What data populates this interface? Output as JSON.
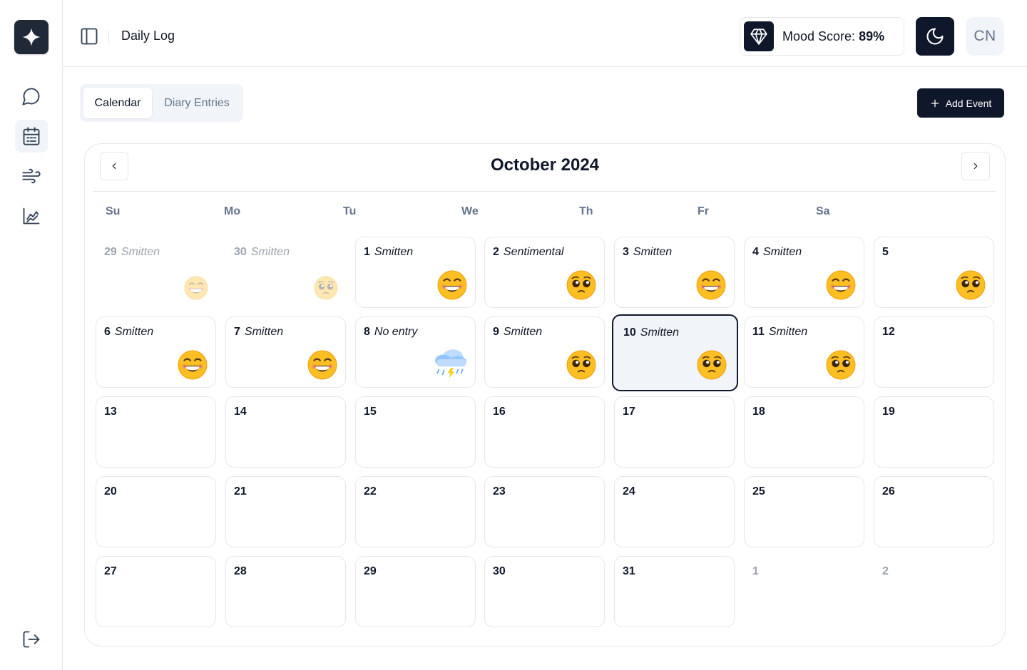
{
  "header": {
    "title": "Daily Log",
    "mood_label": "Mood Score:",
    "mood_value": "89%",
    "avatar_initials": "CN"
  },
  "sidebar": {
    "items": [
      {
        "icon": "chat-icon"
      },
      {
        "icon": "calendar-icon",
        "active": true
      },
      {
        "icon": "wind-icon"
      },
      {
        "icon": "chart-icon"
      }
    ],
    "bottom_icon": "logout-icon"
  },
  "tabs": [
    "Calendar",
    "Diary Entries"
  ],
  "active_tab": "Calendar",
  "add_event_label": "Add Event",
  "calendar": {
    "month_title": "October 2024",
    "weekdays": [
      "Su",
      "Mo",
      "Tu",
      "We",
      "Th",
      "Fr",
      "Sa"
    ],
    "days": [
      {
        "num": "29",
        "mood": "Smitten",
        "emoji": "grin",
        "outside": true
      },
      {
        "num": "30",
        "mood": "Smitten",
        "emoji": "plead",
        "outside": true
      },
      {
        "num": "1",
        "mood": "Smitten",
        "emoji": "grin"
      },
      {
        "num": "2",
        "mood": "Sentimental",
        "emoji": "plead"
      },
      {
        "num": "3",
        "mood": "Smitten",
        "emoji": "grin"
      },
      {
        "num": "4",
        "mood": "Smitten",
        "emoji": "grin"
      },
      {
        "num": "5",
        "mood": "",
        "emoji": "plead"
      },
      {
        "num": "6",
        "mood": "Smitten",
        "emoji": "grin"
      },
      {
        "num": "7",
        "mood": "Smitten",
        "emoji": "grin"
      },
      {
        "num": "8",
        "mood": "No entry",
        "emoji": "storm"
      },
      {
        "num": "9",
        "mood": "Smitten",
        "emoji": "plead"
      },
      {
        "num": "10",
        "mood": "Smitten",
        "emoji": "plead",
        "selected": true
      },
      {
        "num": "11",
        "mood": "Smitten",
        "emoji": "plead"
      },
      {
        "num": "12",
        "mood": "",
        "emoji": ""
      },
      {
        "num": "13",
        "mood": "",
        "emoji": ""
      },
      {
        "num": "14",
        "mood": "",
        "emoji": ""
      },
      {
        "num": "15",
        "mood": "",
        "emoji": ""
      },
      {
        "num": "16",
        "mood": "",
        "emoji": ""
      },
      {
        "num": "17",
        "mood": "",
        "emoji": ""
      },
      {
        "num": "18",
        "mood": "",
        "emoji": ""
      },
      {
        "num": "19",
        "mood": "",
        "emoji": ""
      },
      {
        "num": "20",
        "mood": "",
        "emoji": ""
      },
      {
        "num": "21",
        "mood": "",
        "emoji": ""
      },
      {
        "num": "22",
        "mood": "",
        "emoji": ""
      },
      {
        "num": "23",
        "mood": "",
        "emoji": ""
      },
      {
        "num": "24",
        "mood": "",
        "emoji": ""
      },
      {
        "num": "25",
        "mood": "",
        "emoji": ""
      },
      {
        "num": "26",
        "mood": "",
        "emoji": ""
      },
      {
        "num": "27",
        "mood": "",
        "emoji": ""
      },
      {
        "num": "28",
        "mood": "",
        "emoji": ""
      },
      {
        "num": "29",
        "mood": "",
        "emoji": ""
      },
      {
        "num": "30",
        "mood": "",
        "emoji": ""
      },
      {
        "num": "31",
        "mood": "",
        "emoji": ""
      },
      {
        "num": "1",
        "mood": "",
        "emoji": "",
        "outside": true
      },
      {
        "num": "2",
        "mood": "",
        "emoji": "",
        "outside": true
      }
    ]
  },
  "colors": {
    "primary": "#0f172a",
    "muted_text": "#64748b",
    "border": "#e5e7eb",
    "surface": "#f1f5f9",
    "emoji_yellow": "#fbbf24"
  }
}
